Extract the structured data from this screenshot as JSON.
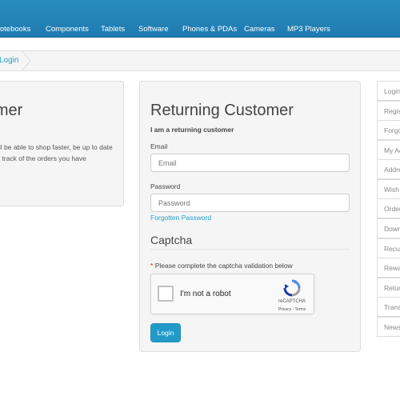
{
  "nav": {
    "items": [
      "Notebooks",
      "Components",
      "Tablets",
      "Software",
      "Phones & PDAs",
      "Cameras",
      "MP3 Players"
    ]
  },
  "breadcrumb": {
    "current": "Login"
  },
  "new_customer": {
    "title": "New Customer",
    "text": "By creating an account you will be able to shop faster, be up to date on an order's status, and keep track of the orders you have previously made."
  },
  "returning": {
    "title": "Returning Customer",
    "subtitle": "I am a returning customer",
    "email_label": "Email",
    "email_placeholder": "Email",
    "password_label": "Password",
    "password_placeholder": "Password",
    "forgotten_link": "Forgotten Password",
    "captcha_title": "Captcha",
    "captcha_required_mark": "*",
    "captcha_note": "Please complete the captcha validation below",
    "recaptcha_label": "I'm not a robot",
    "recaptcha_brand": "reCAPTCHA",
    "recaptcha_terms": "Privacy - Terms",
    "login_button": "Login"
  },
  "sidebar": {
    "items": [
      "Login",
      "Register",
      "Forgotten Password",
      "My Account",
      "Address Book",
      "Wish List",
      "Order History",
      "Downloads",
      "Recurring payments",
      "Reward Points",
      "Returns",
      "Transactions",
      "Newsletter"
    ]
  },
  "colors": {
    "nav_bg": "#1f7bb0",
    "link": "#23a1d1",
    "button": "#229ac8",
    "required": "#ff0000"
  }
}
